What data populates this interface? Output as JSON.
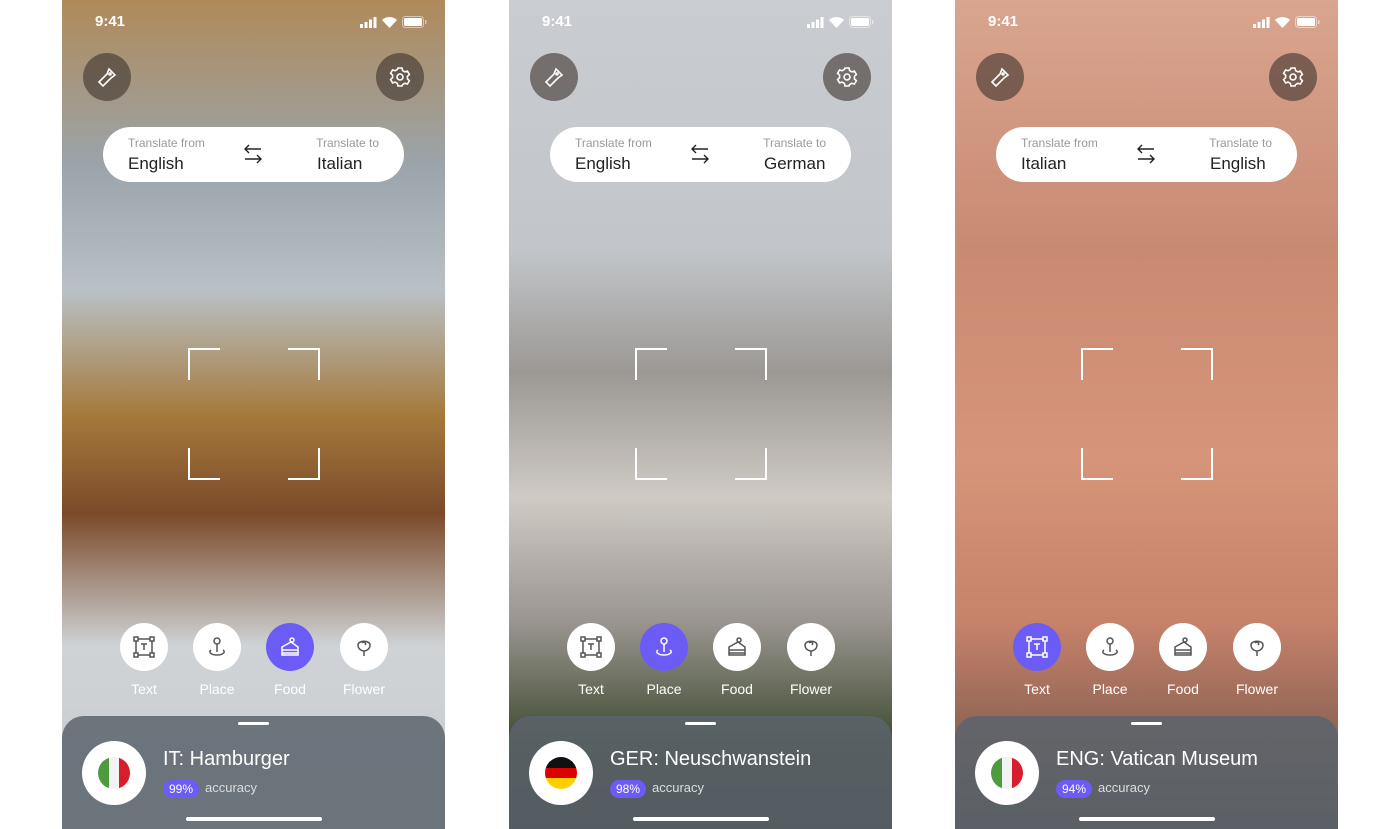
{
  "accent": "#6c5cf6",
  "phones": [
    {
      "time": "9:41",
      "from_label": "Translate from",
      "from": "English",
      "to_label": "Translate to",
      "to": "Italian",
      "modes": [
        {
          "label": "Text",
          "icon": "text-scan-icon"
        },
        {
          "label": "Place",
          "icon": "location-pin-icon"
        },
        {
          "label": "Food",
          "icon": "cake-icon"
        },
        {
          "label": "Flower",
          "icon": "flower-icon"
        }
      ],
      "active_mode": "Food",
      "result": "IT: Hamburger",
      "accuracy": "99%",
      "accuracy_label": "accuracy",
      "flag": [
        "#4d9a3f",
        "#f2f2f2",
        "#d81e2c"
      ],
      "bg": "linear-gradient(180deg,#b08a5a 0%,#9aa4aa 20%,#b9c1c6 35%,#a57a3c 50%,#7b4a2a 62%,#cfd3d6 78%,#c8ccd0 100%)"
    },
    {
      "time": "9:41",
      "from_label": "Translate from",
      "from": "English",
      "to_label": "Translate to",
      "to": "German",
      "modes": [
        {
          "label": "Text",
          "icon": "text-scan-icon"
        },
        {
          "label": "Place",
          "icon": "location-pin-icon"
        },
        {
          "label": "Food",
          "icon": "cake-icon"
        },
        {
          "label": "Flower",
          "icon": "flower-icon"
        }
      ],
      "active_mode": "Place",
      "result": "GER: Neuschwanstein",
      "accuracy": "98%",
      "accuracy_label": "accuracy",
      "flag": [
        "#111111",
        "#dd0000",
        "#ffce00"
      ],
      "bg": "linear-gradient(180deg,#c9ccd0 0%,#c2c6ca 30%,#9c9894 45%,#cfcac4 60%,#9a9590 75%,#3d4a2f 90%,#2c3524 100%)"
    },
    {
      "time": "9:41",
      "from_label": "Translate from",
      "from": "Italian",
      "to_label": "Translate to",
      "to": "English",
      "modes": [
        {
          "label": "Text",
          "icon": "text-scan-icon"
        },
        {
          "label": "Place",
          "icon": "location-pin-icon"
        },
        {
          "label": "Food",
          "icon": "cake-icon"
        },
        {
          "label": "Flower",
          "icon": "flower-icon"
        }
      ],
      "active_mode": "Text",
      "result": "ENG: Vatican Museum",
      "accuracy": "94%",
      "accuracy_label": "accuracy",
      "flag": [
        "#4d9a3f",
        "#f2f2f2",
        "#d81e2c"
      ],
      "bg": "linear-gradient(180deg,#d9a58f 0%,#c98a72 30%,#d6957a 55%,#c7826a 75%,#5e4a44 100%)"
    }
  ]
}
